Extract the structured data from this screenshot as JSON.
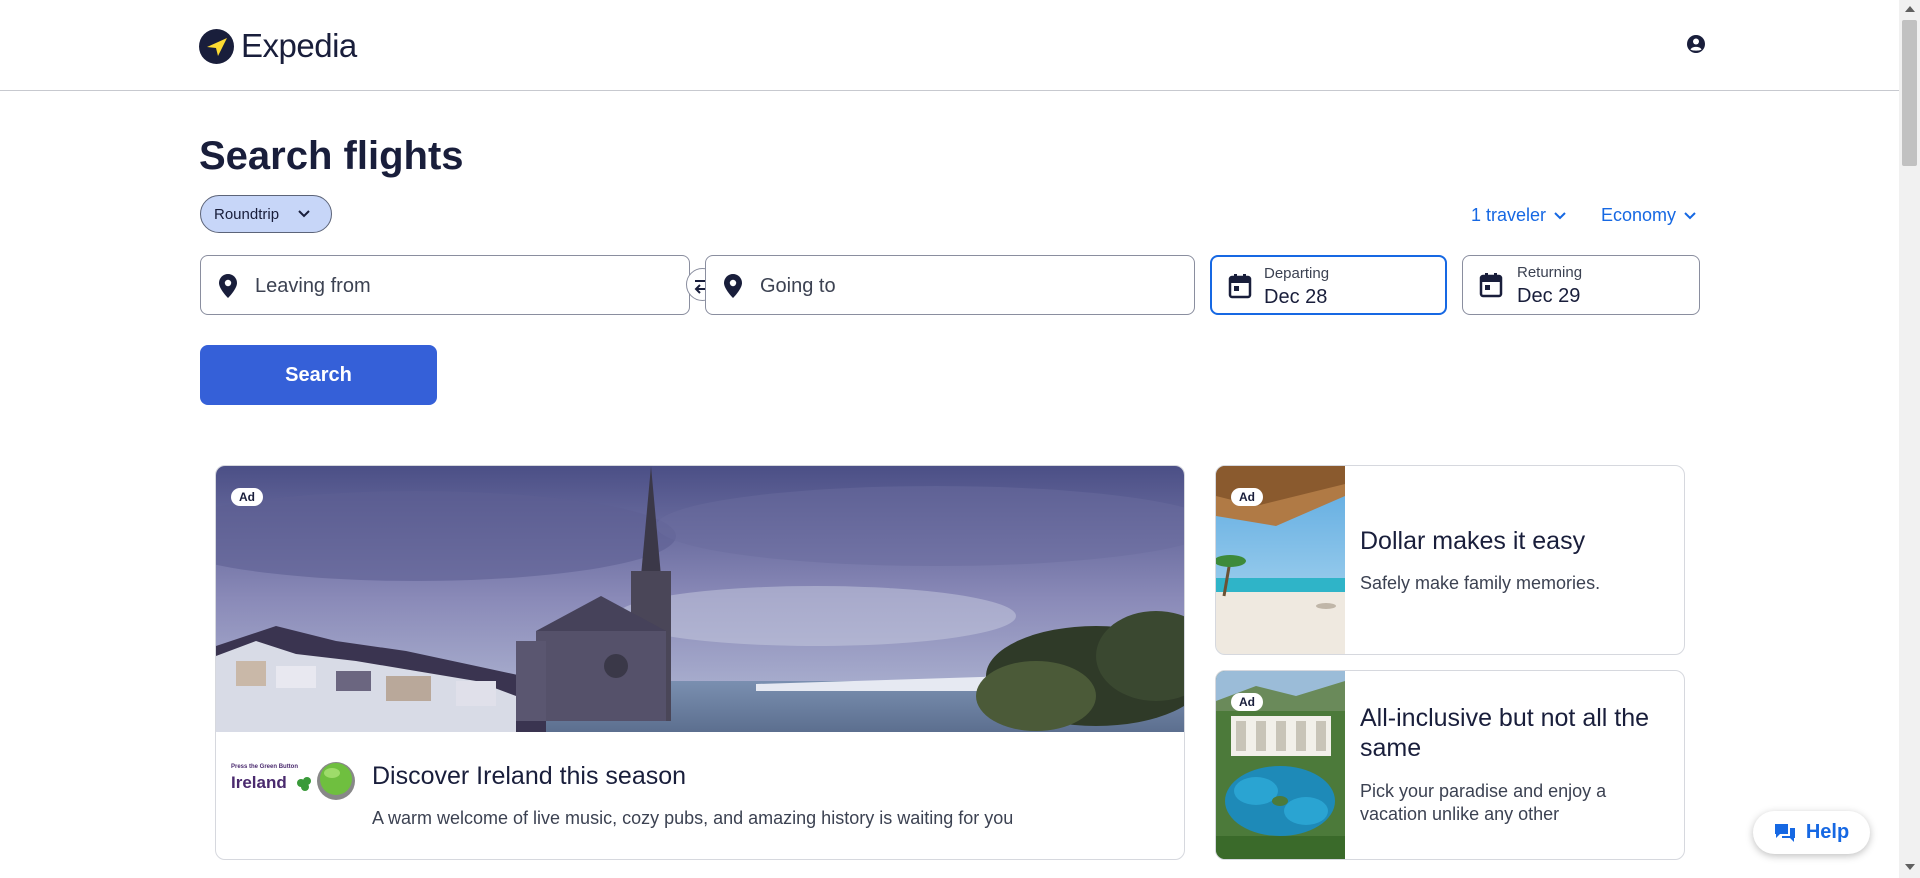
{
  "header": {
    "logo_text": "Expedia",
    "account_icon": "account-circle-icon"
  },
  "page": {
    "title": "Search flights"
  },
  "search": {
    "trip_type": "Roundtrip",
    "travelers": "1 traveler",
    "cabin_class": "Economy",
    "origin_placeholder": "Leaving from",
    "destination_placeholder": "Going to",
    "departing_label": "Departing",
    "departing_value": "Dec 28",
    "returning_label": "Returning",
    "returning_value": "Dec 29",
    "button_label": "Search"
  },
  "ads": {
    "main": {
      "badge": "Ad",
      "title": "Discover Ireland this season",
      "description": "A warm welcome of live music, cozy pubs, and amazing history is waiting for you",
      "brand_tagline": "Press the Green Button",
      "brand_name": "Ireland"
    },
    "side": [
      {
        "badge": "Ad",
        "title": "Dollar makes it easy",
        "description": "Safely make family memories."
      },
      {
        "badge": "Ad",
        "title": "All-inclusive but not all the same",
        "description": "Pick your paradise and enjoy a vacation unlike any other"
      }
    ]
  },
  "help": {
    "label": "Help"
  },
  "colors": {
    "brand_navy": "#191e3b",
    "accent_blue": "#1668e3",
    "search_button": "#3560d8",
    "trip_pill": "#c7d6f8"
  }
}
